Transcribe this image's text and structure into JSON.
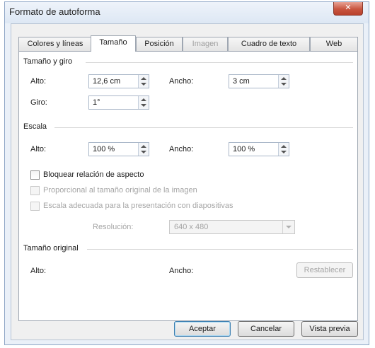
{
  "window": {
    "title": "Formato de autoforma",
    "close_glyph": "✕"
  },
  "tabs": [
    {
      "label": "Colores y líneas",
      "state": "normal"
    },
    {
      "label": "Tamaño",
      "state": "active"
    },
    {
      "label": "Posición",
      "state": "normal"
    },
    {
      "label": "Imagen",
      "state": "disabled"
    },
    {
      "label": "Cuadro de texto",
      "state": "normal"
    },
    {
      "label": "Web",
      "state": "normal"
    }
  ],
  "size_rotate": {
    "title": "Tamaño y giro",
    "alto_label": "Alto:",
    "alto_value": "12,6 cm",
    "ancho_label": "Ancho:",
    "ancho_value": "3 cm",
    "giro_label": "Giro:",
    "giro_value": "1°"
  },
  "scale": {
    "title": "Escala",
    "alto_label": "Alto:",
    "alto_value": "100 %",
    "ancho_label": "Ancho:",
    "ancho_value": "100 %",
    "lock_aspect_label": "Bloquear relación de aspecto",
    "relative_label": "Proporcional al tamaño original de la imagen",
    "best_scale_label": "Escala adecuada para la presentación con diapositivas",
    "resolution_label": "Resolución:",
    "resolution_value": "640 x 480"
  },
  "original_size": {
    "title": "Tamaño original",
    "alto_label": "Alto:",
    "ancho_label": "Ancho:",
    "reset_label": "Restablecer"
  },
  "footer": {
    "ok_label": "Aceptar",
    "cancel_label": "Cancelar",
    "preview_label": "Vista previa"
  }
}
